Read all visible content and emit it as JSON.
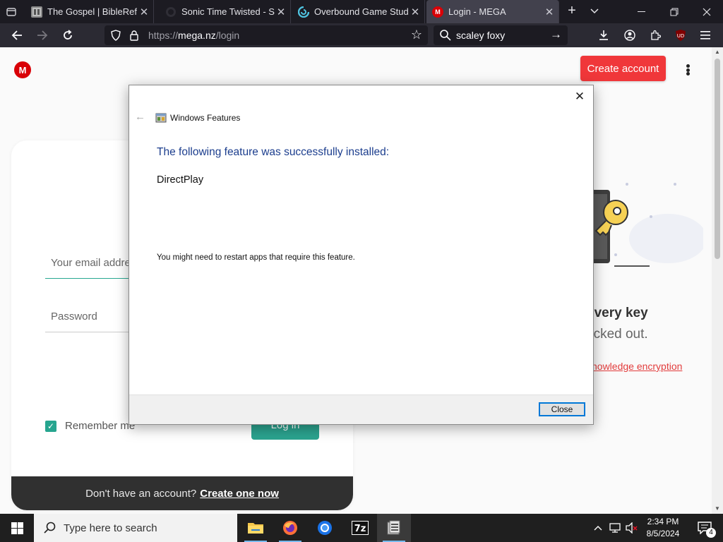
{
  "browser": {
    "tabs": [
      {
        "title": "The Gospel | BibleRef.com",
        "icon": "bibleref-favicon",
        "active": false
      },
      {
        "title": "Sonic Time Twisted - Scaf",
        "icon": "github-favicon",
        "active": false
      },
      {
        "title": "Overbound Game Studio",
        "icon": "overbound-favicon",
        "active": false
      },
      {
        "title": "Login - MEGA",
        "icon": "mega-favicon",
        "active": true
      }
    ],
    "url_scheme": "https://",
    "url_host": "mega.nz",
    "url_path": "/login",
    "search_value": "scaley foxy",
    "ublock_label": "UD"
  },
  "page": {
    "create_account_label": "Create account",
    "logo_letter": "M",
    "email_placeholder": "Your email address",
    "password_placeholder": "Password",
    "remember_label": "Remember me",
    "login_label": "Log in",
    "footer_text": "Don't have an account?",
    "footer_link": "Create one now",
    "recovery_title": "overy key",
    "recovery_sub": "ocked out.",
    "recovery_link": "nowledge encryption"
  },
  "dialog": {
    "app_title": "Windows Features",
    "heading": "The following feature was successfully installed:",
    "feature": "DirectPlay",
    "note": "You might need to restart apps that require this feature.",
    "close_label": "Close"
  },
  "taskbar": {
    "search_placeholder": "Type here to search",
    "time": "2:34 PM",
    "date": "8/5/2024",
    "notification_count": "4",
    "apps": [
      "file-explorer-icon",
      "firefox-icon",
      "chromium-icon",
      "7zip-icon",
      "windows-features-icon"
    ]
  },
  "colors": {
    "mega_red": "#d90007",
    "create_account_bg": "#f0373a",
    "mega_green": "#2ba38f",
    "dialog_heading": "#1c3e8e",
    "dialog_button_border": "#0078d7"
  }
}
